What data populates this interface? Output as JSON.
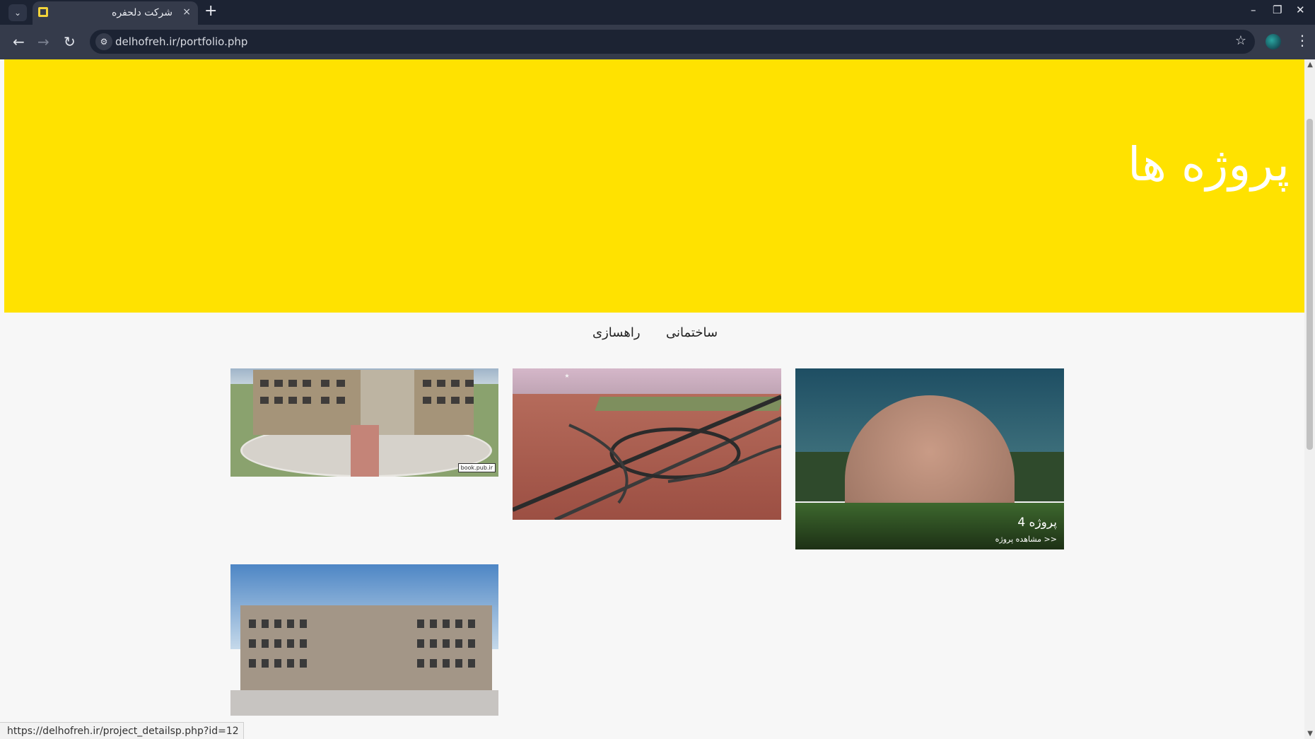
{
  "browser": {
    "tab_title": "شرکت دلحفره",
    "tab_close": "×",
    "new_tab": "+",
    "url": "delhofreh.ir/portfolio.php",
    "status_url": "https://delhofreh.ir/project_detailsp.php?id=12",
    "back_icon": "←",
    "forward_icon": "→",
    "reload_icon": "↻",
    "star_icon": "☆",
    "menu_icon": "⋮",
    "minimize_icon": "–",
    "restore_icon": "❐",
    "close_icon": "✕",
    "tab_search_icon": "⌄",
    "site_info_icon": "⚙"
  },
  "hero": {
    "title": "پروژه ها",
    "background": "#ffe200"
  },
  "filters": [
    {
      "label": "ساختمانی"
    },
    {
      "label": "راهسازی"
    }
  ],
  "projects": [
    {
      "image": "school-building-photo",
      "watermark": "book.pub.ir"
    },
    {
      "image": "highway-interchange-photo",
      "logo_text": "★"
    },
    {
      "image": "dome-building-photo",
      "title": "پروژه 4",
      "link": "<< مشاهده پروژه"
    },
    {
      "image": "office-building-photo"
    }
  ]
}
